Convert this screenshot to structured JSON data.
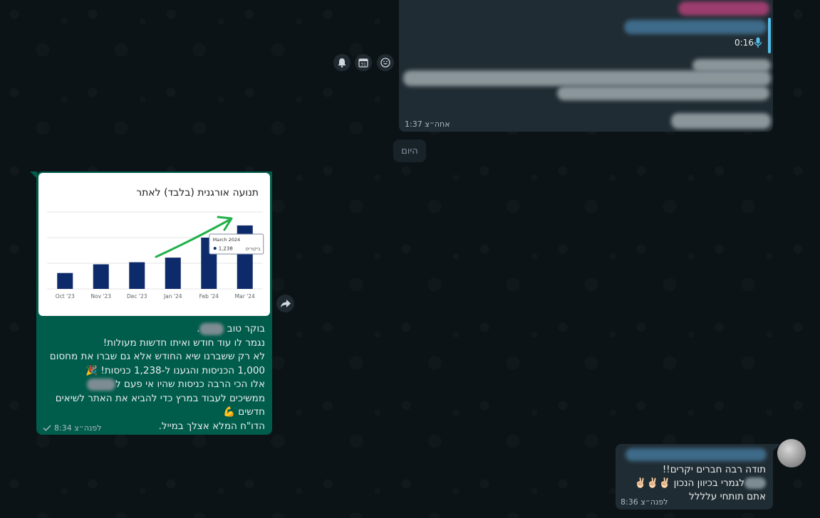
{
  "top_message": {
    "voice_duration": "0:16",
    "time": "1:37 אחה״צ"
  },
  "date_divider": "היום",
  "outgoing_message": {
    "chart_data": {
      "type": "bar",
      "title": "תנועה אורגנית (בלבד) לאתר",
      "categories": [
        "Oct '23",
        "Nov '23",
        "Dec '23",
        "Jan '24",
        "Feb '24",
        "Mar '24"
      ],
      "values": [
        310,
        480,
        520,
        610,
        1000,
        1238
      ],
      "ylim": [
        0,
        1500
      ],
      "grid": true,
      "tooltip": {
        "date": "March 2024",
        "label": "ביקורים",
        "value": "1,238"
      }
    },
    "lines": [
      "בוקר טוב",
      "נגמר לו עוד חודש ואיתו חדשות מעולות!",
      "לא רק ששברנו שיא החודש אלא גם שברו את מחסום",
      "1,000 הכניסות והגענו ל-1,238 כניסות! 🎉",
      "אלו הכי הרבה כניסות שהיו אי פעם ל",
      "ממשיכים לעבוד במרץ כדי להביא את האתר לשיאים",
      "חדשים 💪",
      "הדו\"ח המלא אצלך במייל."
    ],
    "time": "8:34 לפנה״צ",
    "colors": {
      "bubble": "#005c4b",
      "bar": "#0d2a6b",
      "arrow": "#22b14c"
    }
  },
  "incoming_message": {
    "lines": [
      "תודה רבה חברים יקרים!!",
      "לגמרי בכיוון הנכון ✌🏻✌🏻✌🏻",
      "אתם תותחי עלללל"
    ],
    "time": "8:36 לפנה״צ"
  }
}
